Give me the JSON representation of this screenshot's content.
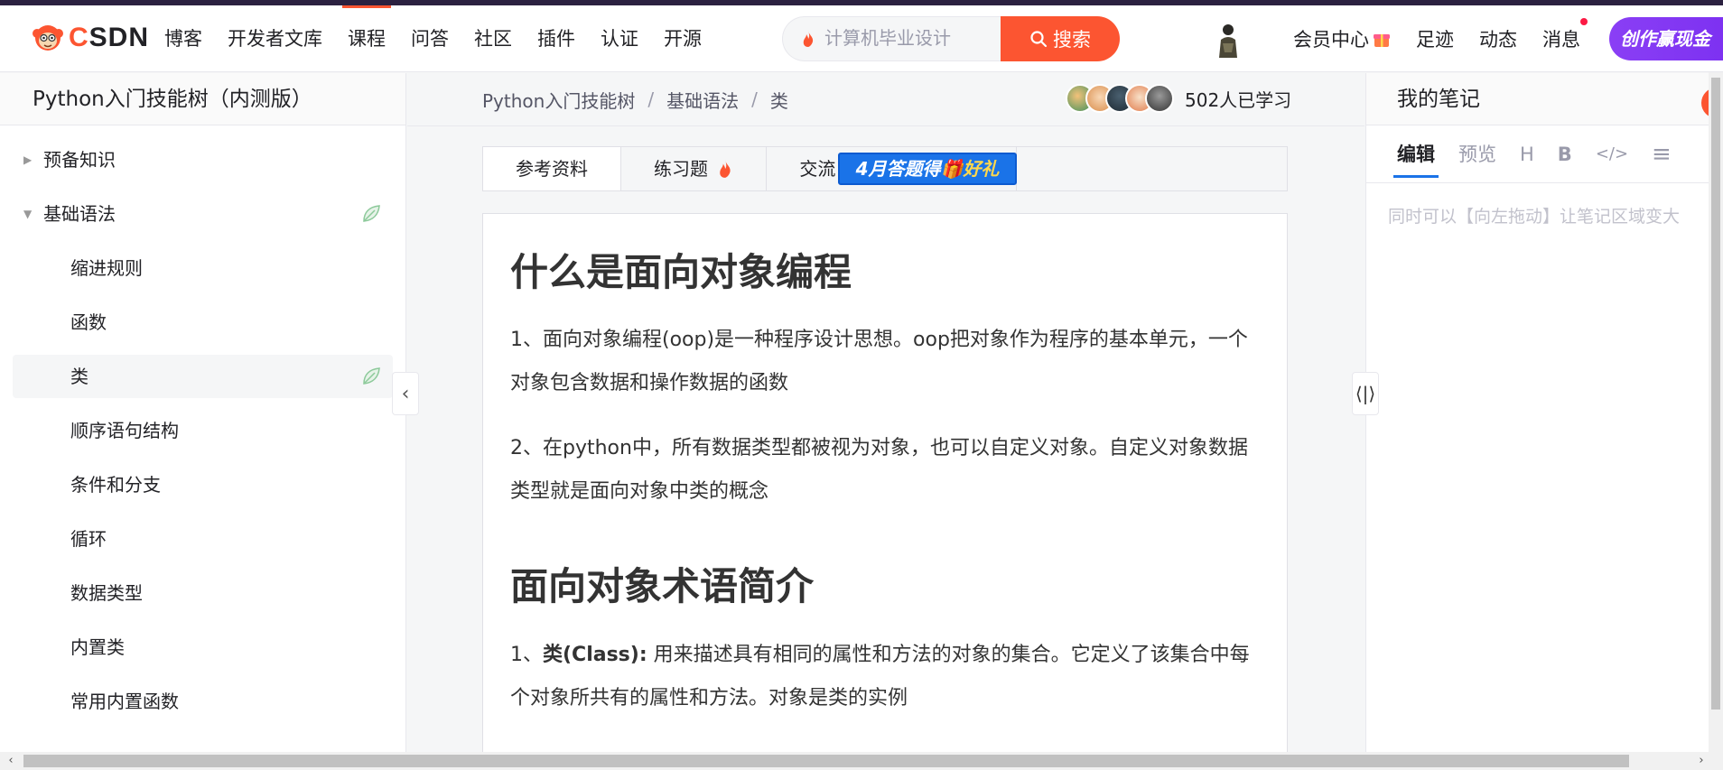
{
  "header": {
    "logo_text_c": "C",
    "logo_text_rest": "SDN",
    "nav": [
      "博客",
      "开发者文库",
      "课程",
      "问答",
      "社区",
      "插件",
      "认证",
      "开源"
    ],
    "active_nav_index": 2,
    "search": {
      "placeholder": "计算机毕业设计",
      "button_label": "搜索"
    },
    "right_nav": {
      "vip": "会员中心",
      "footprint": "足迹",
      "dynamic": "动态",
      "messages": "消息"
    },
    "create_button": "创作赢现金"
  },
  "sidebar": {
    "title": "Python入门技能树（内测版）",
    "items": [
      {
        "label": "预备知识",
        "level": 0,
        "expanded": false
      },
      {
        "label": "基础语法",
        "level": 0,
        "expanded": true,
        "leaf_icon": true
      },
      {
        "label": "缩进规则",
        "level": 1
      },
      {
        "label": "函数",
        "level": 1
      },
      {
        "label": "类",
        "level": 1,
        "selected": true,
        "leaf_icon": true
      },
      {
        "label": "顺序语句结构",
        "level": 1
      },
      {
        "label": "条件和分支",
        "level": 1
      },
      {
        "label": "循环",
        "level": 1
      },
      {
        "label": "数据类型",
        "level": 1
      },
      {
        "label": "内置类",
        "level": 1
      },
      {
        "label": "常用内置函数",
        "level": 1
      }
    ]
  },
  "breadcrumb": [
    "Python入门技能树",
    "基础语法",
    "类"
  ],
  "learners_text": "502人已学习",
  "tabs": [
    {
      "label": "参考资料",
      "active": true
    },
    {
      "label": "练习题",
      "active": false
    },
    {
      "label": "交流",
      "active": false
    }
  ],
  "promo": {
    "part1": "4月答题得",
    "part2": "好礼"
  },
  "content": {
    "h1": "什么是面向对象编程",
    "p1": "1、面向对象编程(oop)是一种程序设计思想。oop把对象作为程序的基本单元，一个对象包含数据和操作数据的函数",
    "p2": "2、在python中，所有数据类型都被视为对象，也可以自定义对象。自定义对象数据类型就是面向对象中类的概念",
    "h2": "面向对象术语简介",
    "p3_prefix": "1、",
    "p3_bold": "类(Class):",
    "p3_rest": " 用来描述具有相同的属性和方法的对象的集合。它定义了该集合中每个对象所共有的属性和方法。对象是类的实例"
  },
  "notes": {
    "title": "我的笔记",
    "toolbar": {
      "edit": "编辑",
      "preview": "预览",
      "heading": "H",
      "bold": "B",
      "code": "</>",
      "list": "≡"
    },
    "placeholder": "同时可以【向左拖动】让笔记区域变大"
  },
  "colors": {
    "brand": "#fc5531",
    "accent": "#1a73e8",
    "create": "#8a3ff5"
  }
}
